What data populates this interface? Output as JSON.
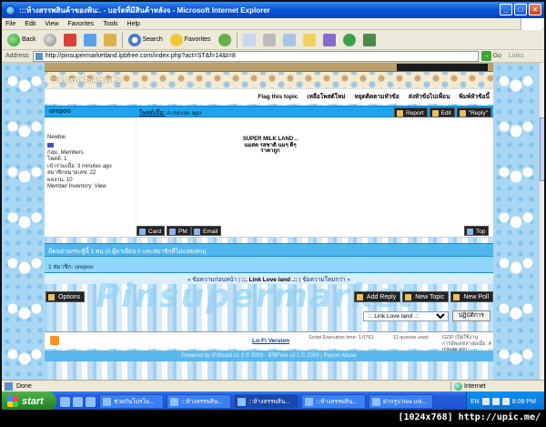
{
  "window": {
    "title": ":::ห้างสรรพสินค้าของพิน:. - บอร์ดที่มีสินค้าหลังจ - Microsoft Internet Explorer",
    "controls": [
      "_",
      "□",
      "×"
    ]
  },
  "menubar": {
    "items": [
      "File",
      "Edit",
      "View",
      "Favorites",
      "Tools",
      "Help"
    ]
  },
  "toolbar": {
    "back": "Back",
    "search": "Search",
    "favorites": "Favorites"
  },
  "address": {
    "label": "Address",
    "url": "http://pinsupermarketland.ipbfree.com/index.php?act=ST&f=14&t=8",
    "go": "Go",
    "links": "Links"
  },
  "forum": {
    "header_title": ":::ห้างสรรพสินค้าของพิน:",
    "topic_actions": [
      "Flag this topic",
      "เหลือโพสต์ใหม่",
      "หยุดติดตามหัวข้อ",
      "ส่งหัวข้อไปเพื่อน",
      "พิมพ์หัวข้อนี้"
    ],
    "post": {
      "author": "orepoo",
      "time_label": "โพสต์เมื่อ:",
      "time_value": "A minute ago",
      "buttons": [
        "Report",
        "Edit",
        "\"Reply\""
      ],
      "user_rank": "Newbie",
      "user_info": [
        "กลุ่ม: Members",
        "โพสต์: 1",
        "เข้าร่วมเมื่อ: 3 minutes ago",
        "สมาชิกหมายเลข: 22",
        "ผลงาน: 10",
        "Member Inventory: View"
      ],
      "message_lines": [
        "SUPER MILK LAND ..",
        "นมสด รสชาติ นมๆ ดีๆ",
        "ราคาถูก"
      ],
      "footer_buttons": [
        "Card",
        "PM",
        "Email"
      ],
      "top_button": "Top"
    },
    "readers_summary": "มีคนอ่านกระทู้นี้ 1 คน (0 ผู้มาเยือน 0 และสมาชิกที่ไม่แสดงตน)",
    "readers_list": "1 สมาชิก: orepoo",
    "nav": {
      "prev": "« ข้อความก่อนหน้า",
      "current": "::. Link Love land .::",
      "next": "ข้อความใหม่กว่า »"
    },
    "options_button": "Options",
    "bottom_buttons": [
      "Add Reply",
      "New Topic",
      "New Poll"
    ],
    "watermark": "Pinsupermarket",
    "jump": {
      "selected": "::. Link Love land .::",
      "go": "ปฏิบัติการ"
    },
    "stats": {
      "lofi": "Lo-Fi Version",
      "exec_time": "Script Execution time: 1.0763",
      "queries": "11 queries used",
      "gzip": "GZIP เปิดใช้งาน",
      "last_update": "การอัพเดทล่าสุดเมื่อ: A minute ago"
    },
    "copyright": "Powered by IP.Board v1.3 © 2003 - IPBFree v2.1 © 2009 | Report Abuse"
  },
  "statusbar": {
    "text": "Done",
    "zone": "Internet"
  },
  "taskbar": {
    "start": "start",
    "tasks": [
      "ช่วยกันโปรโม...",
      ":::ห้างสรรพสิน...",
      ":::ห้างสรรพสิน...",
      ":::ห้างสรรพสิน...",
      "ฝากรูป free unl..."
    ],
    "lang": "EN",
    "clock": "8:09 PM"
  },
  "overlay": "[1024x768] http://upic.me/",
  "colors": {
    "accent": "#1fa3ea",
    "title_bar": "#0a56d6",
    "taskbar": "#245edc",
    "start": "#2f8f2f"
  }
}
